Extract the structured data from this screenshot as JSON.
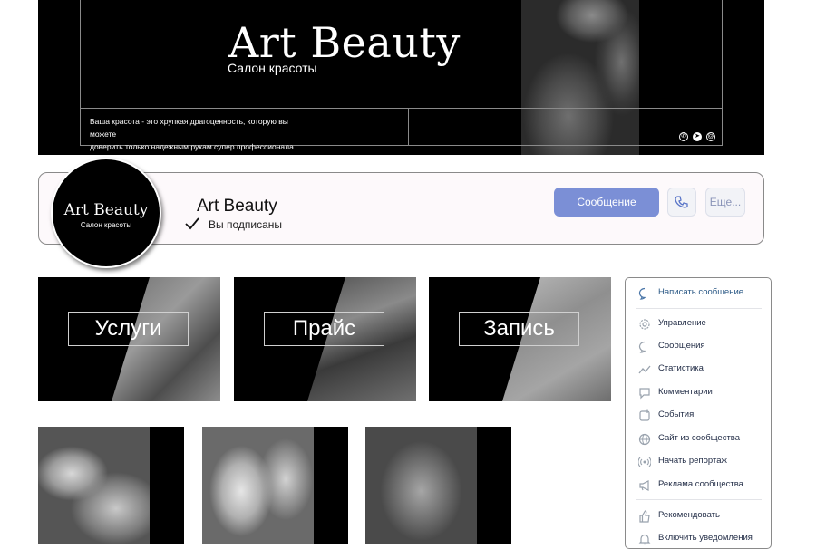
{
  "cover": {
    "title": "Art Beauty",
    "subtitle": "Салон красоты",
    "tagline_line1": "Ваша красота - это хрупкая драгоценность, которую вы можете",
    "tagline_line2": "доверить только надежным рукам супер профессионала",
    "icons": [
      "phone-icon",
      "telegram-icon",
      "email-icon"
    ]
  },
  "profile": {
    "avatar_title": "Art Beauty",
    "avatar_subtitle": "Салон красоты",
    "name": "Art Beauty",
    "subscription_status": "Вы подписаны",
    "message_button": "Сообщение",
    "more_button": "Еще...",
    "accent_color": "#7b8fd6"
  },
  "tiles": [
    {
      "label": "Услуги"
    },
    {
      "label": "Прайс"
    },
    {
      "label": "Запись"
    }
  ],
  "photo_cards": [
    "manicure-photo",
    "pedicure-photo",
    "nails-photo"
  ],
  "menu": {
    "items": [
      {
        "label": "Написать сообщение",
        "icon": "message-icon",
        "color": "#2a5885"
      },
      {
        "label": "Управление",
        "icon": "gear-icon"
      },
      {
        "label": "Сообщения",
        "icon": "chat-icon"
      },
      {
        "label": "Статистика",
        "icon": "stats-icon"
      },
      {
        "label": "Комментарии",
        "icon": "comment-icon"
      },
      {
        "label": "События",
        "icon": "events-icon"
      },
      {
        "label": "Сайт из сообщества",
        "icon": "globe-icon"
      },
      {
        "label": "Начать репортаж",
        "icon": "broadcast-icon"
      },
      {
        "label": "Реклама сообщества",
        "icon": "megaphone-icon"
      },
      {
        "label": "Рекомендовать",
        "icon": "like-icon"
      },
      {
        "label": "Включить уведомления",
        "icon": "bell-icon"
      }
    ]
  }
}
